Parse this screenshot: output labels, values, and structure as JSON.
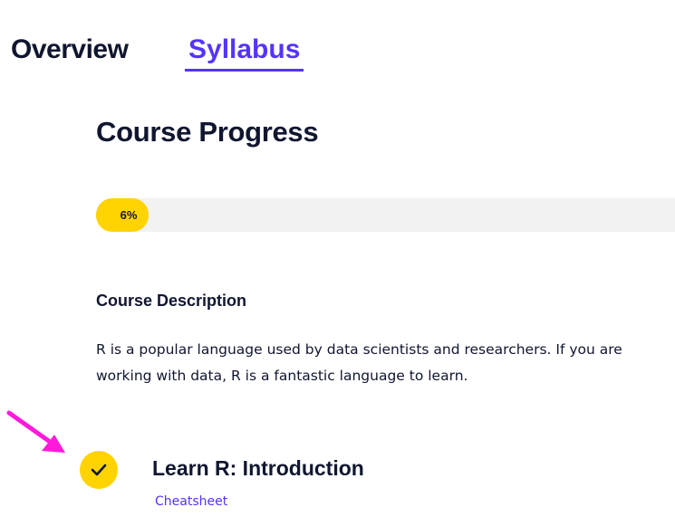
{
  "tabs": {
    "overview_label": "Overview",
    "syllabus_label": "Syllabus"
  },
  "main": {
    "title": "Course Progress",
    "progress": {
      "percent": 6,
      "label": "6%"
    },
    "description": {
      "heading": "Course Description",
      "text": "R is a popular language used by data scientists and researchers. If you are working with data, R is a fantastic language to learn."
    },
    "modules": [
      {
        "title": "Learn R: Introduction",
        "link_label": "Cheatsheet",
        "completed": true
      }
    ]
  },
  "colors": {
    "accent": "#5533ff",
    "progress_fill": "#ffd300",
    "progress_track": "#f2f2f2",
    "text": "#10162f",
    "annotation_arrow": "#ff1adb"
  },
  "icons": {
    "module_status": "checkmark-icon",
    "annotation": "arrow-pointer-icon"
  }
}
